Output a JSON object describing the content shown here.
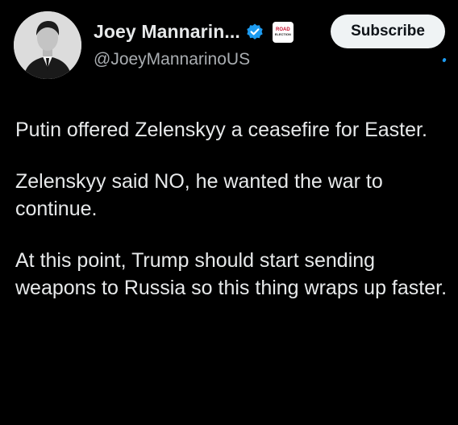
{
  "author": {
    "display_name": "Joey Mannarin...",
    "handle": "@JoeyMannarinoUS",
    "verified": true,
    "affiliate_badge_text": [
      "ROAD",
      "ELECTION"
    ]
  },
  "actions": {
    "subscribe_label": "Subscribe"
  },
  "tweet": {
    "paragraphs": [
      "Putin offered Zelenskyy a ceasefire for Easter.",
      "Zelenskyy said NO, he wanted the war to continue.",
      "At this point, Trump should start sending weapons to Russia so this thing wraps up faster."
    ]
  },
  "icons": {
    "verified": "verified-check-icon",
    "affiliate": "affiliate-badge-icon"
  },
  "colors": {
    "background": "#000000",
    "text": "#e7e9ea",
    "secondary_text": "#a9adb1",
    "verified_blue": "#1d9bf0",
    "subscribe_bg": "#eff3f4",
    "subscribe_text": "#0f1419"
  }
}
